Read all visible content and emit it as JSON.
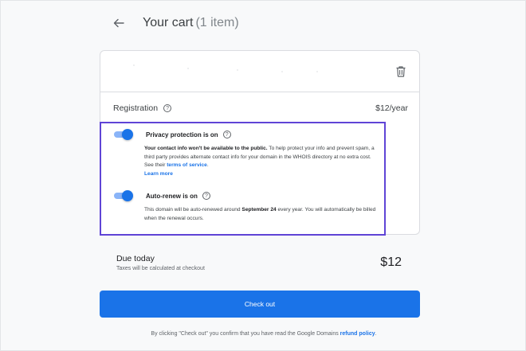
{
  "header": {
    "back_icon": "arrow-left-icon",
    "title": "Your cart",
    "item_count": "(1 item)"
  },
  "cart": {
    "delete_icon": "trash-icon",
    "registration_label": "Registration",
    "registration_price": "$12/year"
  },
  "privacy": {
    "title": "Privacy protection is on",
    "body_bold": "Your contact info won't be available to the public.",
    "body_text": " To help protect your info and prevent spam, a third party provides alternate contact info for your domain in the WHOIS directory at no extra cost. See their ",
    "terms_link": "terms of service",
    "body_end": ".",
    "learn_more": "Learn more"
  },
  "autorenew": {
    "title": "Auto-renew is on",
    "body_start": "This domain will be auto-renewed around ",
    "body_bold": "September 24",
    "body_end": " every year. You will automatically be billed when the renewal occurs."
  },
  "summary": {
    "due_today": "Due today",
    "taxes_note": "Taxes will be calculated at checkout",
    "total": "$12"
  },
  "checkout_label": "Check out",
  "footer": {
    "text": "By clicking \"Check out\" you confirm that you have read the Google Domains ",
    "link": "refund policy",
    "end": "."
  },
  "colors": {
    "accent": "#1a73e8",
    "highlight_border": "#5f44d6"
  }
}
